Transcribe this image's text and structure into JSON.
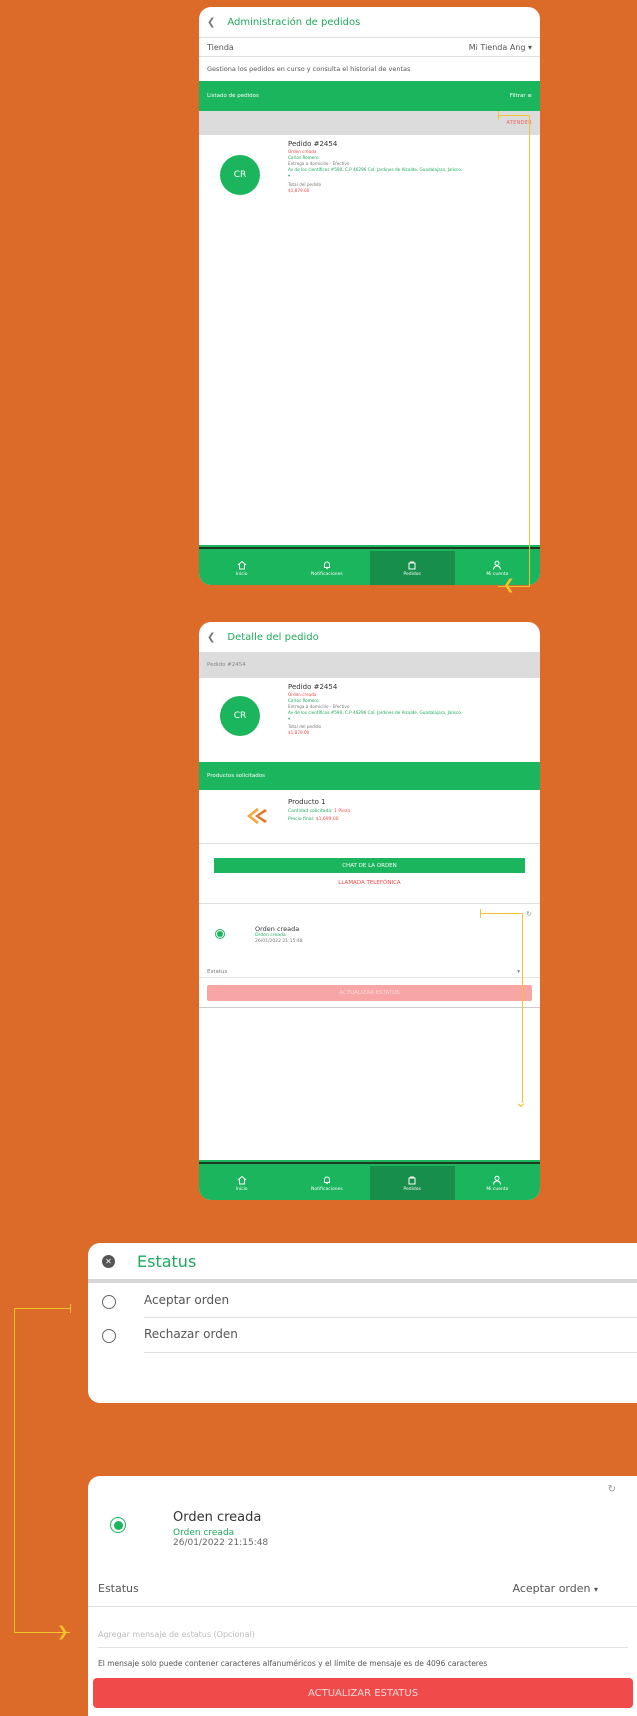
{
  "screen1": {
    "header_title": "Administración de pedidos",
    "store_label": "Tienda",
    "store_value": "Mi Tienda Ang",
    "description": "Gestiona los pedidos en curso y consulta el historial de ventas",
    "list_title": "Listado de pedidos",
    "filter_label": "Filtrar",
    "attend_label": "ATENDER",
    "order": {
      "avatar": "CR",
      "title": "Pedido #2454",
      "status": "Orden creada",
      "customer": "Carlos Romero",
      "delivery": "Entrega a domicilio - Efectivo",
      "address": "Av de los científicos #590, C.P 46296 Col. Jardines de Alcalde, Guadalajara, Jalisco.",
      "total_label": "Total del pedido",
      "total_value": "$1,879.00"
    }
  },
  "nav": [
    "Inicio",
    "Notificaciones",
    "Pedidos",
    "Mi cuenta"
  ],
  "screen2": {
    "header_title": "Detalle del pedido",
    "order_ref": "Pedido #2454",
    "products_title": "Productos solicitados",
    "product": {
      "name": "Producto 1",
      "qty_label": "Cantidad solicitada:",
      "qty_value": "1 Pieza",
      "price_label": "Precio final:",
      "price_value": "$1,699.00"
    },
    "chat_button": "CHAT DE LA ORDEN",
    "call_button": "LLAMADA TELEFÓNICA",
    "status_title": "Orden creada",
    "status_sub": "Orden creada",
    "status_date": "26/01/2022 21:15:48",
    "status_label": "Estatus",
    "update_button": "ACTUALIZAR ESTATUS"
  },
  "dialog": {
    "title": "Estatus",
    "options": [
      "Aceptar orden",
      "Rechazar orden"
    ]
  },
  "final_card": {
    "status_title": "Orden creada",
    "status_sub": "Orden creada",
    "status_date": "26/01/2022 21:15:48",
    "status_label": "Estatus",
    "status_value": "Aceptar orden",
    "message_placeholder": "Agregar mensaje de estatus (Opcional)",
    "hint": "El mensaje solo puede contener caracteres alfanuméricos y el límite de mensaje es de 4096 caracteres",
    "update_button": "ACTUALIZAR ESTATUS"
  },
  "colors": {
    "brand_green": "#1ab55c",
    "accent_red": "#f04a4a",
    "background_orange": "#dc6a28",
    "connector": "#f4c430"
  }
}
